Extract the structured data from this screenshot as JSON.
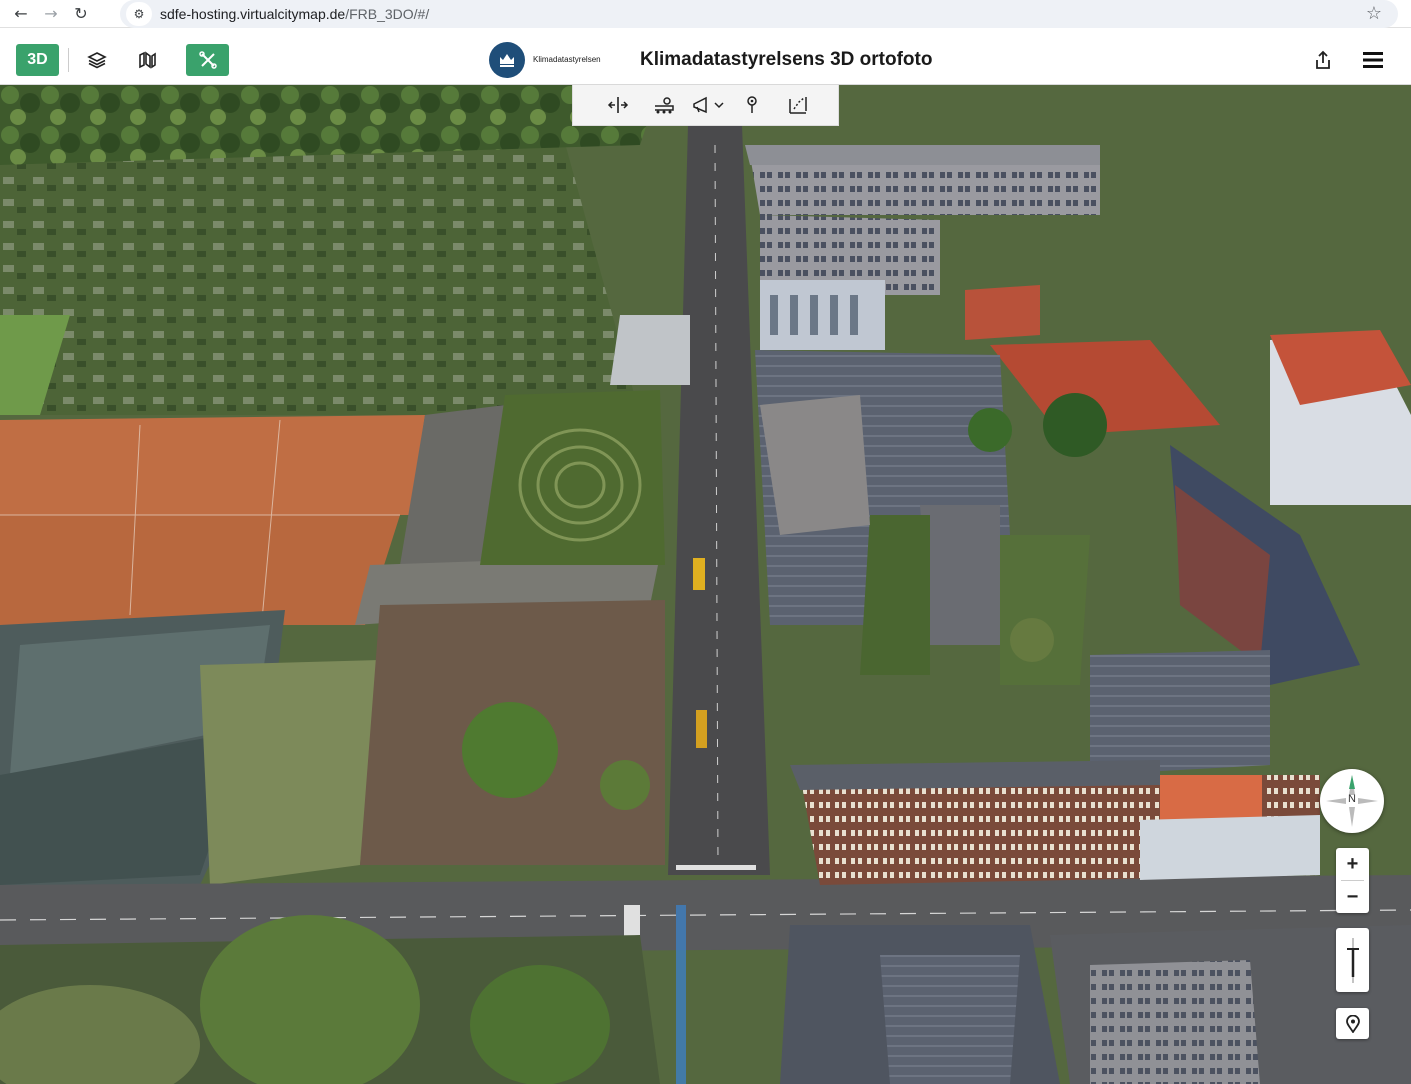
{
  "browser": {
    "back_icon": "arrow-left-icon",
    "forward_icon": "arrow-right-icon",
    "reload_icon": "reload-icon",
    "url_host": "sdfe-hosting.virtualcitymap.de",
    "url_path": "/FRB_3DO/#/",
    "bookmark_icon": "star-icon"
  },
  "header": {
    "mode_button": "3D",
    "layers_icon": "layers-icon",
    "map_style_icon": "map-style-icon",
    "tools_icon": "tools-icon",
    "logo_text": "Klimadatastyrelsen",
    "title": "Klimadatastyrelsens 3D ortofoto",
    "share_icon": "share-icon",
    "menu_icon": "hamburger-menu-icon"
  },
  "toolbar": {
    "items": [
      "split-view-icon",
      "viewshed-icon",
      "flight-icon",
      "point-info-icon",
      "measure-icon"
    ]
  },
  "controls": {
    "compass_label": "N",
    "zoom_in": "+",
    "zoom_out": "−"
  },
  "colors": {
    "accent_green": "#3aa26c",
    "logo_blue": "#1f4e79"
  }
}
